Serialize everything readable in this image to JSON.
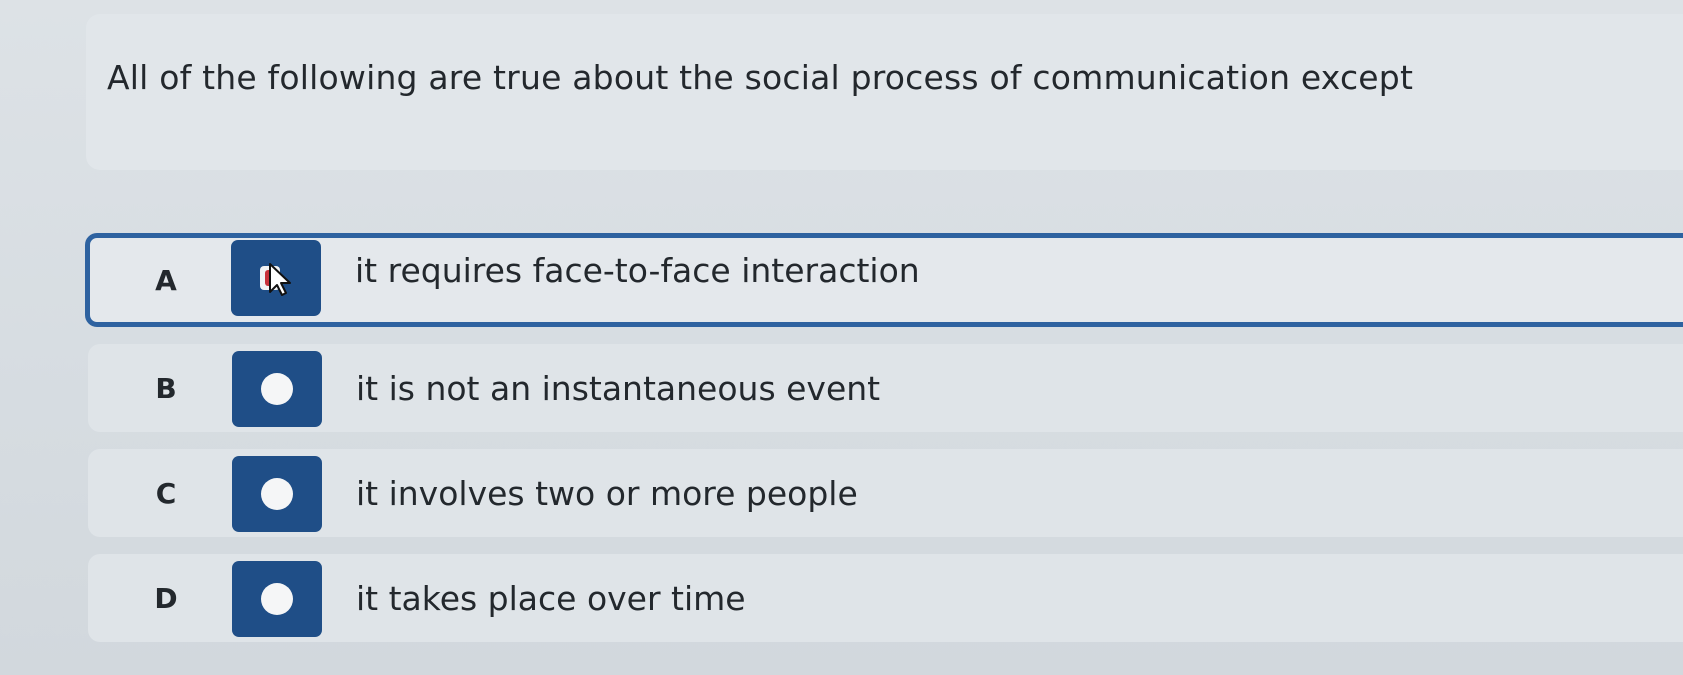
{
  "question": {
    "text": "All of the following are true about the social process of communication except"
  },
  "options": [
    {
      "letter": "A",
      "text": "it requires face-to-face interaction",
      "selected": true
    },
    {
      "letter": "B",
      "text": "it is not an instantaneous event",
      "selected": false
    },
    {
      "letter": "C",
      "text": "it involves two or more people",
      "selected": false
    },
    {
      "letter": "D",
      "text": "it takes place over time",
      "selected": false
    }
  ],
  "colors": {
    "accent": "#2e62a0",
    "radio_bg": "#1f4e87",
    "radio_dot": "#f5f6f7",
    "page_bg": "#d8dde2"
  },
  "icons": {
    "selected_cursor": "mouse-pointer-icon"
  }
}
